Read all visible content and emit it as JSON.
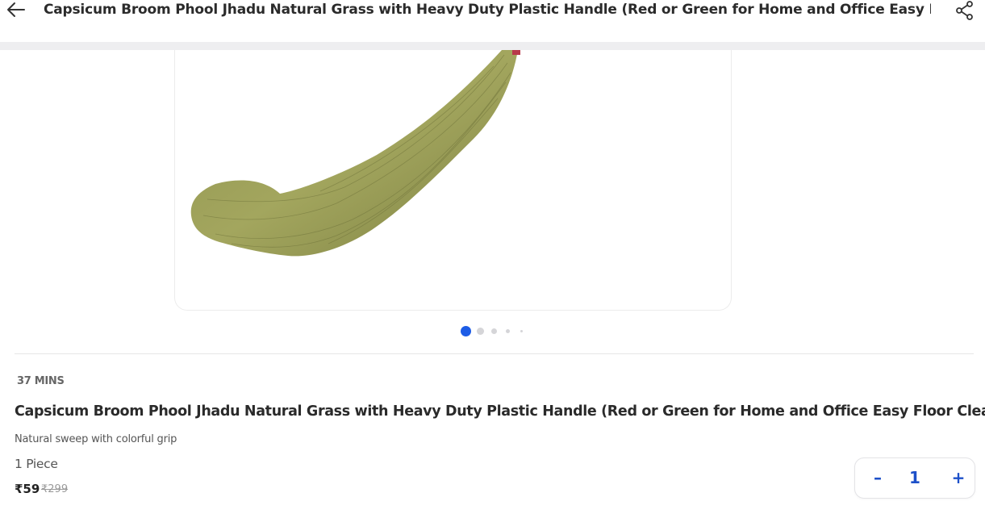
{
  "header": {
    "back_icon": "arrow-left-icon",
    "title": "Capsicum Broom Phool Jhadu Natural Grass with Heavy Duty Plastic Handle (Red or Green for Home and Office Easy Floor ...",
    "share_icon": "share-icon"
  },
  "gallery": {
    "image_subject": "broom",
    "dot_count": 5,
    "active_index": 0,
    "active_color": "#1d5ce6"
  },
  "product": {
    "delivery_time": "37 MINS",
    "name": "Capsicum Broom Phool Jhadu Natural Grass with Heavy Duty Plastic Handle (Red or Green for Home and Office Easy Floor Cleaning)",
    "description": "Natural sweep with colorful grip",
    "quantity_label": "1 Piece",
    "price": "₹59",
    "mrp": "₹299"
  },
  "cart": {
    "decrement": "–",
    "count": "1",
    "increment": "+",
    "accent_color": "#1d50c9"
  }
}
